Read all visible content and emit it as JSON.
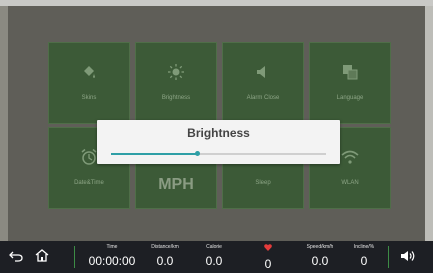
{
  "settings_tiles": [
    {
      "label": "Skins",
      "icon": "paint-bucket-icon"
    },
    {
      "label": "Brightness",
      "icon": "brightness-icon"
    },
    {
      "label": "Alarm Close",
      "icon": "speaker-icon"
    },
    {
      "label": "Language",
      "icon": "language-icon"
    },
    {
      "label": "Date&Time",
      "icon": "alarm-clock-icon"
    },
    {
      "label": "MPH",
      "icon": ""
    },
    {
      "label": "Sleep",
      "icon": "sleep-icon"
    },
    {
      "label": "WLAN",
      "icon": "wifi-icon"
    }
  ],
  "dialog": {
    "title": "Brightness",
    "brightness_level": 0.4
  },
  "status_bar": {
    "time": {
      "label": "Time",
      "value": "00:00:00"
    },
    "distance": {
      "label": "Distance/km",
      "value": "0.0"
    },
    "calorie": {
      "label": "Calorie",
      "value": "0.0"
    },
    "heart_rate": {
      "value": "0"
    },
    "speed": {
      "label": "Speed/km/h",
      "value": "0.0"
    },
    "incline": {
      "label": "Incline/%",
      "value": "0"
    }
  },
  "colors": {
    "tile_bg": "#3c5a37",
    "accent": "#2e9fa6",
    "heart": "#e43b3b",
    "divider": "#3d8c46"
  }
}
